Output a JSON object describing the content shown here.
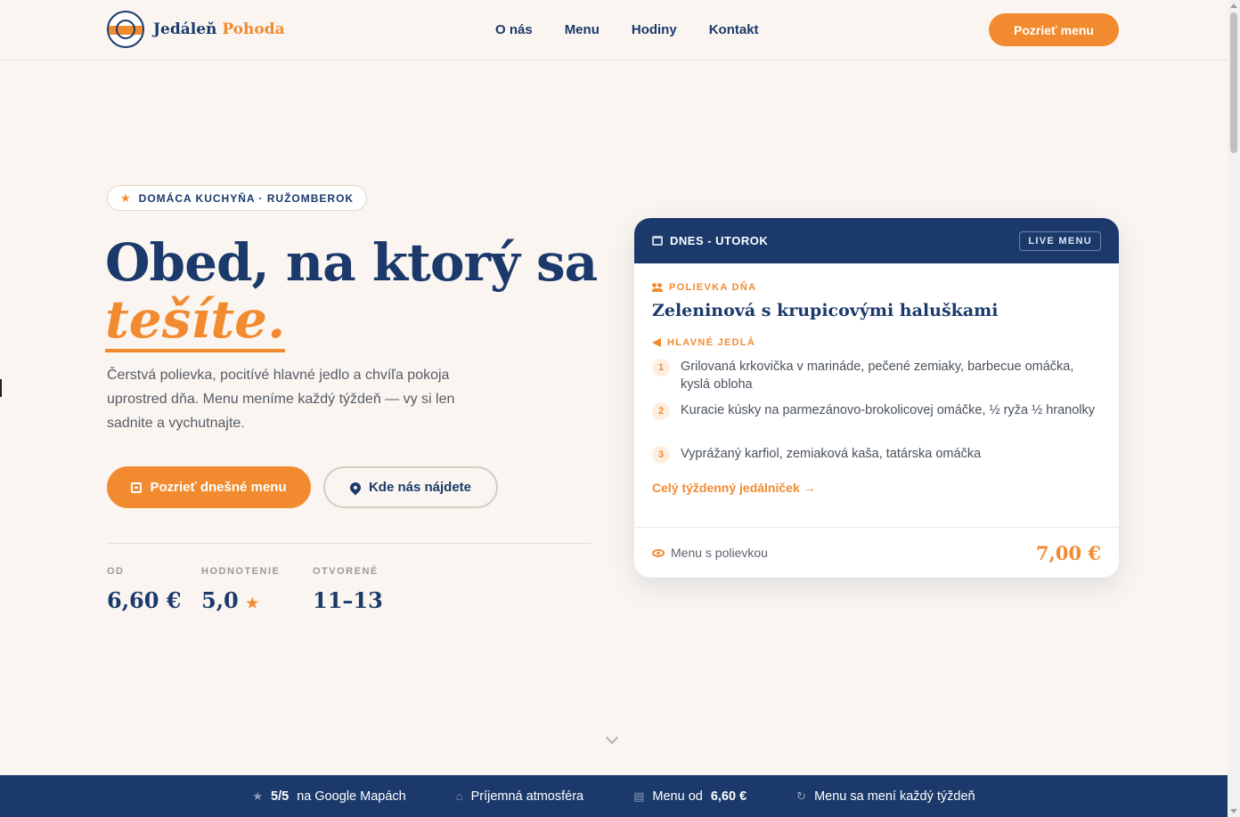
{
  "header": {
    "logo_icon": "restaurant-seal-icon",
    "brand_first": "Jedáleň",
    "brand_second": "Pohoda",
    "nav": [
      "O nás",
      "Menu",
      "Hodiny",
      "Kontakt"
    ],
    "cta": "Pozrieť menu"
  },
  "hero": {
    "badge": "DOMÁCA KUCHYŇA · RUŽOMBEROK",
    "title_line1": "Obed, na ktorý sa",
    "title_line2": "tešíte.",
    "lead": "Čerstvá polievka, pocitívé hlavné jedlo a chvíľa pokoja uprostred dňa. Menu meníme každý týždeň — vy si len sadnite a vychutnajte.",
    "primary_button": "Pozrieť dnešné menu",
    "secondary_button": "Kde nás nájdete",
    "stats": [
      {
        "label": "OD",
        "value": "6,60 €"
      },
      {
        "label": "HODNOTENIE",
        "value": "5,0"
      },
      {
        "label": "OTVORENÉ",
        "value": "11–13"
      }
    ]
  },
  "card": {
    "day": "DNES - UTOROK",
    "live": "LIVE MENU",
    "soup_label": "POLIEVKA DŇA",
    "soup": "Zeleninová s krupicovými haluškami",
    "mains_label": "HLAVNÉ JEDLÁ",
    "dishes": [
      {
        "num": "1",
        "text": "Grilovaná krkovička v marináde, pečené zemiaky, barbecue omáčka, kyslá obloha"
      },
      {
        "num": "2",
        "text": "Kuracie kúsky na parmezánovo-brokolicovej omáčke, ½ ryža ½ hranolky"
      },
      {
        "num": "3",
        "text": "Vyprážaný karfiol, zemiaková kaša, tatárska omáčka"
      }
    ],
    "week_link": "Celý týždenný jedálniček →",
    "footer_note": "Menu s polievkou",
    "price": "7,00 €"
  },
  "strip": {
    "rating_strong": "5/5",
    "rating_rest": "na Google Mapách",
    "atmosphere": "Príjemná atmosféra",
    "menu_from_label": "Menu od",
    "menu_from_value": "6,60 €",
    "weekly": "Menu sa mení každý týždeň"
  },
  "colors": {
    "navy": "#1b3a6b",
    "orange": "#f28b30",
    "background": "#faf5f0"
  }
}
